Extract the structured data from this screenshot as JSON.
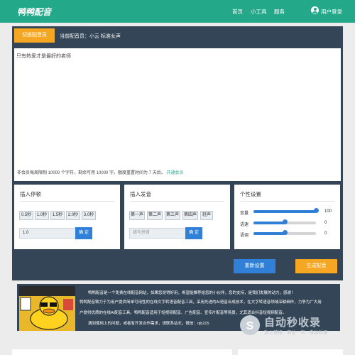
{
  "nav": {
    "logo": "鸭鸭配音",
    "links": [
      "首页",
      "小工具",
      "服务"
    ],
    "login": "用户登录"
  },
  "toolbar": {
    "switch_voice": "切换配音员",
    "current_voice": "当前配音员：小云 标准女声"
  },
  "editor": {
    "text": "只有热爱才是最好的老师"
  },
  "notice": {
    "text": "非会员每周限制 10000 个字符，剩余可用 10000 字。额度重置时间为 7 天后。",
    "link": "开通会员"
  },
  "pause_panel": {
    "title": "插入停顿",
    "chips": [
      "0.5秒",
      "1.0秒",
      "1.5秒",
      "2.0秒",
      "3.0秒"
    ],
    "input_value": "1.0",
    "confirm": "确 定"
  },
  "pronounce_panel": {
    "title": "插入发音",
    "chips": [
      "第一声",
      "第二声",
      "第三声",
      "第四声",
      "轻声"
    ],
    "input_placeholder": "填写拼音",
    "confirm": "确 定"
  },
  "settings_panel": {
    "title": "个性设置",
    "sliders": [
      {
        "label": "音量",
        "value": "100",
        "fraction": 1.0
      },
      {
        "label": "语速",
        "value": "0",
        "fraction": 0.5
      },
      {
        "label": "语调",
        "value": "0",
        "fraction": 0.5
      }
    ]
  },
  "actions": {
    "reset": "重新设置",
    "generate": "生成配音"
  },
  "about": {
    "lines": [
      "鸭鸭配音是一个免费在线配音网站，如果您觉得好用，希望能推荐给您的小伙伴，您的支持，是我们发展的动力，感谢！",
      "鸭鸭配音致力于为用户提供简单可用性的在线文字转语音配音工具，采用先进的AI语音合成技术，在文字转语音领域深耕细作，力争为广大用",
      "户提供优质的在线AI配音工具。鸭鸭配音适用于短视频配音、广告配音、宣传片配音等场景，尤其适合抖音短视频配音。",
      "遇到使用上的问题，或者有开发合作需求，请联系站长，微信：njb215"
    ]
  },
  "watermark": {
    "title": "自动秒收录",
    "subtitle": "放上链接 · 来访一次 · 自动收录"
  },
  "colors": {
    "nav": "#23a98a",
    "panel_bg": "#344557",
    "accent_orange": "#f5a623",
    "accent_blue": "#2f80d6"
  }
}
